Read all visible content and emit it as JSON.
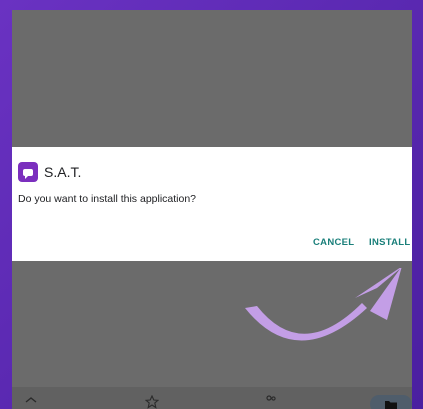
{
  "dialog": {
    "app_name": "S.A.T.",
    "question": "Do you want to install this application?",
    "cancel_label": "CANCEL",
    "install_label": "INSTALL"
  },
  "icons": {
    "app": "chat-bubble-app-icon",
    "annotation": "curved-arrow-pointing-to-install",
    "nav": [
      "home-icon",
      "star-icon",
      "people-icon",
      "folder-icon"
    ]
  },
  "colors": {
    "accent": "#1a7f7a",
    "app_icon": "#7b2fbe",
    "arrow": "#c39ee6",
    "frame": "#5b2bb0"
  }
}
